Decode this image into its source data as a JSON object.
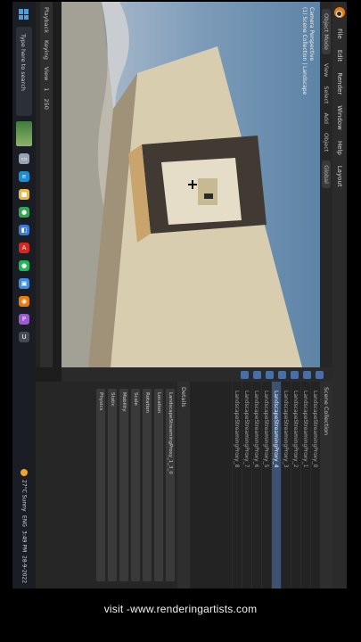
{
  "blender": {
    "menu": [
      "Blender",
      "File",
      "Edit",
      "Render",
      "Window",
      "Help"
    ],
    "workspace": "Layout",
    "viewport_header": {
      "mode": "Object Mode",
      "view": "View",
      "select": "Select",
      "add": "Add",
      "object": "Object",
      "transform": "Global"
    },
    "viewport_info": [
      "Camera Perspective",
      "(1) Scene Collection | Landscape"
    ],
    "outliner": {
      "title": "Scene Collection",
      "rows": [
        "LandscapeStreamingProxy_0",
        "LandscapeStreamingProxy_1",
        "LandscapeStreamingProxy_2",
        "LandscapeStreamingProxy_3",
        "LandscapeStreamingProxy_4",
        "LandscapeStreamingProxy_5",
        "LandscapeStreamingProxy_6",
        "LandscapeStreamingProxy_7",
        "LandscapeStreamingProxy_8"
      ]
    },
    "properties": {
      "title": "Details",
      "selected": "LandscapeStreamingProxy_1_3_0",
      "fields": [
        "Location",
        "Rotation",
        "Scale",
        "Mobility",
        "Static",
        "Physics"
      ]
    },
    "timeline": {
      "frame_start": "1",
      "frame_end": "250",
      "playback": "Playback",
      "keying": "Keying",
      "view": "View"
    }
  },
  "taskbar": {
    "search_placeholder": "Type here to search",
    "weather": "27°C Sunny",
    "language": "ENG",
    "time": "3:49 PM",
    "date": "28-9-2022",
    "apps": [
      {
        "name": "task-view-icon",
        "color": "#9aa3b2",
        "glyph": "▭"
      },
      {
        "name": "edge-icon",
        "color": "#1f8dd6",
        "glyph": "e"
      },
      {
        "name": "file-explorer-icon",
        "color": "#e9b949",
        "glyph": "■"
      },
      {
        "name": "chrome-icon",
        "color": "#2fa84f",
        "glyph": "●"
      },
      {
        "name": "store-icon",
        "color": "#3a7bd5",
        "glyph": "◧"
      },
      {
        "name": "acrobat-icon",
        "color": "#d7261e",
        "glyph": "A"
      },
      {
        "name": "spotify-icon",
        "color": "#1db954",
        "glyph": "●"
      },
      {
        "name": "photos-icon",
        "color": "#3a8de0",
        "glyph": "▣"
      },
      {
        "name": "blender-icon",
        "color": "#e87d0d",
        "glyph": "◉"
      },
      {
        "name": "premiere-icon",
        "color": "#9a5ad6",
        "glyph": "P"
      },
      {
        "name": "unreal-icon",
        "color": "#444b57",
        "glyph": "U"
      }
    ]
  },
  "caption": "visit -www.renderingartists.com"
}
